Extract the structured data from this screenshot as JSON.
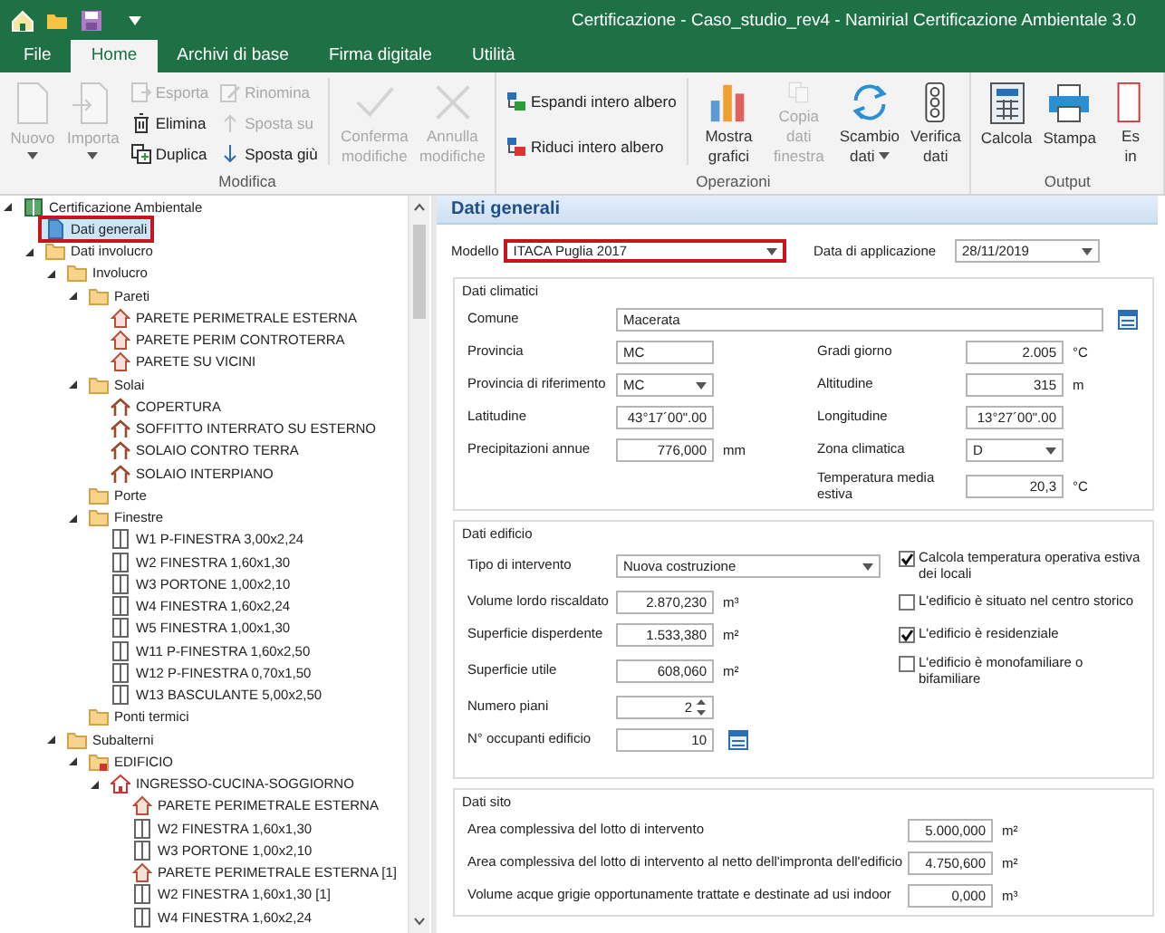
{
  "window": {
    "title": "Certificazione - Caso_studio_rev4 - Namirial Certificazione Ambientale 3.0"
  },
  "tabs": [
    {
      "label": "File",
      "selected": false
    },
    {
      "label": "Home",
      "selected": true
    },
    {
      "label": "Archivi di base",
      "selected": false
    },
    {
      "label": "Firma digitale",
      "selected": false
    },
    {
      "label": "Utilità",
      "selected": false
    }
  ],
  "ribbon_groups": [
    {
      "label": "Modifica",
      "buttons": [
        {
          "kind": "large",
          "label": "Nuovo",
          "disabled": true,
          "dropdown": true
        },
        {
          "kind": "large",
          "label": "Importa",
          "disabled": true,
          "dropdown": true
        },
        {
          "kind": "small",
          "label": "Esporta",
          "disabled": true
        },
        {
          "kind": "small",
          "label": "Elimina",
          "disabled": false
        },
        {
          "kind": "small",
          "label": "Duplica",
          "disabled": false
        },
        {
          "kind": "small",
          "label": "Rinomina",
          "disabled": true
        },
        {
          "kind": "small",
          "label": "Sposta su",
          "disabled": true
        },
        {
          "kind": "small",
          "label": "Sposta giù",
          "disabled": false
        },
        {
          "kind": "separator"
        },
        {
          "kind": "large",
          "label": "Conferma modifiche",
          "disabled": true
        },
        {
          "kind": "large",
          "label": "Annulla modifiche",
          "disabled": true
        }
      ]
    },
    {
      "label": "Operazioni",
      "buttons": [
        {
          "kind": "small",
          "label": "Espandi intero albero",
          "disabled": false
        },
        {
          "kind": "small",
          "label": "Riduci intero albero",
          "disabled": false
        },
        {
          "kind": "separator"
        },
        {
          "kind": "large",
          "label": "Mostra grafici",
          "disabled": false
        },
        {
          "kind": "large",
          "label": "Copia dati finestra",
          "disabled": true
        },
        {
          "kind": "large",
          "label": "Scambio dati",
          "disabled": false,
          "dropdown": true
        },
        {
          "kind": "large",
          "label": "Verifica dati",
          "disabled": false
        }
      ]
    },
    {
      "label": "Output",
      "buttons": [
        {
          "kind": "large",
          "label": "Calcola",
          "disabled": false
        },
        {
          "kind": "large",
          "label": "Stampa",
          "disabled": false
        },
        {
          "kind": "large",
          "label": "Es in",
          "disabled": false
        }
      ]
    }
  ],
  "tree": [
    {
      "kind": "root",
      "label": "Certificazione Ambientale",
      "expanded": true,
      "selected": false,
      "children": [
        {
          "kind": "document",
          "label": "Dati generali",
          "selected": true,
          "highlighted": true
        },
        {
          "kind": "folder",
          "label": "Dati involucro",
          "expanded": true,
          "selected": false,
          "children": [
            {
              "kind": "folder",
              "label": "Involucro",
              "expanded": true,
              "selected": false,
              "children": [
                {
                  "kind": "folder",
                  "label": "Pareti",
                  "expanded": true,
                  "selected": false,
                  "children": [
                    {
                      "kind": "wall",
                      "label": "PARETE PERIMETRALE ESTERNA",
                      "selected": false
                    },
                    {
                      "kind": "wall",
                      "label": "PARETE PERIM CONTROTERRA",
                      "selected": false
                    },
                    {
                      "kind": "wall",
                      "label": "PARETE SU VICINI",
                      "selected": false
                    }
                  ]
                },
                {
                  "kind": "folder",
                  "label": "Solai",
                  "expanded": true,
                  "selected": false,
                  "children": [
                    {
                      "kind": "roof",
                      "label": "COPERTURA",
                      "selected": false
                    },
                    {
                      "kind": "roof",
                      "label": "SOFFITTO INTERRATO SU ESTERNO",
                      "selected": false
                    },
                    {
                      "kind": "roof",
                      "label": "SOLAIO CONTRO TERRA",
                      "selected": false
                    },
                    {
                      "kind": "roof",
                      "label": "SOLAIO INTERPIANO",
                      "selected": false
                    }
                  ]
                },
                {
                  "kind": "folder",
                  "label": "Porte",
                  "selected": false
                },
                {
                  "kind": "folder",
                  "label": "Finestre",
                  "expanded": true,
                  "selected": false,
                  "children": [
                    {
                      "kind": "window",
                      "label": "W1 P-FINESTRA 3,00x2,24",
                      "selected": false
                    },
                    {
                      "kind": "window",
                      "label": "W2 FINESTRA 1,60x1,30",
                      "selected": false
                    },
                    {
                      "kind": "window",
                      "label": "W3 PORTONE 1,00x2,10",
                      "selected": false
                    },
                    {
                      "kind": "window",
                      "label": "W4  FINESTRA 1,60x2,24",
                      "selected": false
                    },
                    {
                      "kind": "window",
                      "label": "W5  FINESTRA 1,00x1,30",
                      "selected": false
                    },
                    {
                      "kind": "window",
                      "label": "W11  P-FINESTRA 1,60x2,50",
                      "selected": false
                    },
                    {
                      "kind": "window",
                      "label": "W12  P-FINESTRA 0,70x1,50",
                      "selected": false
                    },
                    {
                      "kind": "window",
                      "label": "W13 BASCULANTE 5,00x2,50",
                      "selected": false
                    }
                  ]
                },
                {
                  "kind": "folder",
                  "label": "Ponti termici",
                  "selected": false
                }
              ]
            },
            {
              "kind": "folder",
              "label": "Subalterni",
              "expanded": true,
              "selected": false,
              "children": [
                {
                  "kind": "locked-folder",
                  "label": "EDIFICIO",
                  "expanded": true,
                  "selected": false,
                  "children": [
                    {
                      "kind": "room",
                      "label": "INGRESSO-CUCINA-SOGGIORNO",
                      "expanded": true,
                      "selected": false,
                      "children": [
                        {
                          "kind": "wall",
                          "label": "PARETE PERIMETRALE ESTERNA",
                          "selected": false
                        },
                        {
                          "kind": "window",
                          "label": "W2 FINESTRA 1,60x1,30",
                          "selected": false
                        },
                        {
                          "kind": "window",
                          "label": "W3 PORTONE 1,00x2,10",
                          "selected": false
                        },
                        {
                          "kind": "wall",
                          "label": "PARETE PERIMETRALE ESTERNA [1]",
                          "selected": false
                        },
                        {
                          "kind": "window",
                          "label": "W2 FINESTRA 1,60x1,30 [1]",
                          "selected": false
                        },
                        {
                          "kind": "window",
                          "label": "W4  FINESTRA 1,60x2,24",
                          "selected": false
                        }
                      ]
                    }
                  ]
                }
              ]
            }
          ]
        }
      ]
    }
  ],
  "panel": {
    "title": "Dati generali",
    "top_fields": [
      {
        "kind": "select",
        "label": "Modello",
        "value": "ITACA Puglia 2017",
        "highlighted": true
      },
      {
        "kind": "select",
        "label": "Data di applicazione",
        "value": "28/11/2019",
        "highlighted": false
      }
    ],
    "sections": [
      {
        "title": "Dati climatici",
        "rows": [
          {
            "full": {
              "kind": "text",
              "label": "Comune",
              "value": "Macerata",
              "picker": true
            }
          },
          {
            "left": {
              "kind": "text",
              "label": "Provincia",
              "value": "MC"
            },
            "right": {
              "kind": "number",
              "label": "Gradi giorno",
              "value": "2.005",
              "unit": "°C"
            }
          },
          {
            "left": {
              "kind": "select",
              "label": "Provincia di riferimento",
              "value": "MC"
            },
            "right": {
              "kind": "number",
              "label": "Altitudine",
              "value": "315",
              "unit": "m"
            }
          },
          {
            "left": {
              "kind": "number",
              "label": "Latitudine",
              "value": "43°17´00\".00"
            },
            "right": {
              "kind": "number",
              "label": "Longitudine",
              "value": "13°27´00\".00"
            }
          },
          {
            "left": {
              "kind": "number",
              "label": "Precipitazioni annue",
              "value": "776,000",
              "unit": "mm"
            },
            "right": {
              "kind": "select",
              "label": "Zona climatica",
              "value": "D"
            }
          },
          {
            "right": {
              "kind": "number",
              "label": "Temperatura media estiva",
              "value": "20,3",
              "unit": "°C"
            }
          }
        ]
      },
      {
        "title": "Dati edificio",
        "rows": [
          {
            "left": {
              "kind": "select",
              "label": "Tipo di intervento",
              "value": "Nuova costruzione"
            },
            "right": {
              "kind": "checkbox",
              "label": "Calcola temperatura operativa estiva dei locali",
              "checked": true
            }
          },
          {
            "left": {
              "kind": "number",
              "label": "Volume lordo riscaldato",
              "value": "2.870,230",
              "unit": "m³"
            },
            "right": {
              "kind": "checkbox",
              "label": "L'edificio è situato nel centro storico",
              "checked": false
            }
          },
          {
            "left": {
              "kind": "number",
              "label": "Superficie disperdente",
              "value": "1.533,380",
              "unit": "m²"
            },
            "right": {
              "kind": "checkbox",
              "label": "L'edificio è residenziale",
              "checked": true
            }
          },
          {
            "left": {
              "kind": "number",
              "label": "Superficie utile",
              "value": "608,060",
              "unit": "m²"
            },
            "right": {
              "kind": "checkbox",
              "label": "L'edificio è monofamiliare o bifamiliare",
              "checked": false
            }
          },
          {
            "left": {
              "kind": "spin",
              "label": "Numero piani",
              "value": "2"
            }
          },
          {
            "left": {
              "kind": "number",
              "label": "N° occupanti edificio",
              "value": "10",
              "picker": true
            }
          }
        ]
      },
      {
        "title": "Dati sito",
        "rows": [
          {
            "full": {
              "kind": "number",
              "label": "Area complessiva del lotto di intervento",
              "value": "5.000,000",
              "unit": "m²"
            }
          },
          {
            "full": {
              "kind": "number",
              "label": "Area complessiva del lotto di intervento al netto dell'impronta dell'edificio",
              "value": "4.750,600",
              "unit": "m²"
            }
          },
          {
            "full": {
              "kind": "number",
              "label": "Volume acque grigie opportunamente trattate e destinate ad usi indoor",
              "value": "0,000",
              "unit": "m³"
            }
          }
        ]
      }
    ]
  }
}
